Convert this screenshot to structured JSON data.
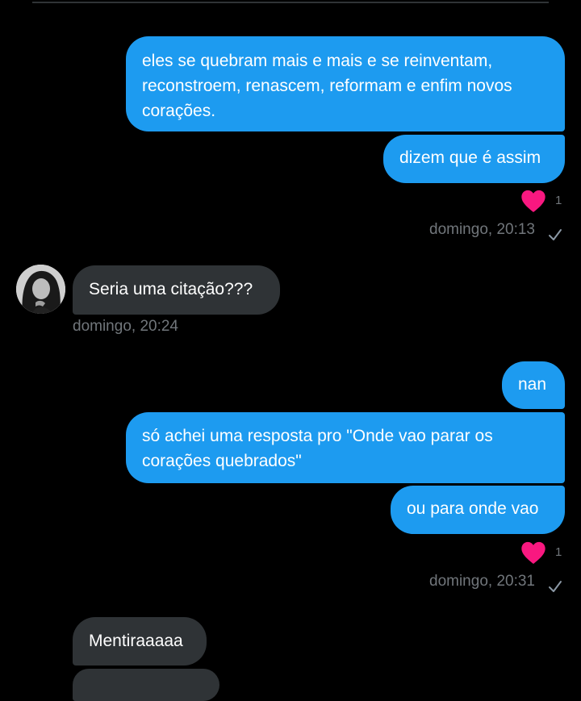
{
  "colors": {
    "background": "#000000",
    "outgoing_bubble": "#1d9bf0",
    "incoming_bubble": "#2f3336",
    "timestamp": "#71767b",
    "heart": "#f91880"
  },
  "messages": [
    {
      "direction": "out",
      "text": "eles se quebram mais e mais e se reinventam, reconstroem, renascem, reformam e enfim novos corações."
    },
    {
      "direction": "out",
      "text": "dizem que é assim"
    },
    {
      "direction": "in",
      "text": "Seria uma citação???"
    },
    {
      "direction": "out",
      "text": "nan"
    },
    {
      "direction": "out",
      "text": "só achei uma resposta pro \"Onde vao parar os corações quebrados\""
    },
    {
      "direction": "out",
      "text": "ou para onde vao"
    },
    {
      "direction": "in",
      "text": "Mentiraaaaa"
    }
  ],
  "reactions": [
    {
      "icon": "heart-icon",
      "count": "1"
    },
    {
      "icon": "heart-icon",
      "count": "1"
    }
  ],
  "timestamps": [
    "domingo, 20:13",
    "domingo, 20:24",
    "domingo, 20:31"
  ]
}
